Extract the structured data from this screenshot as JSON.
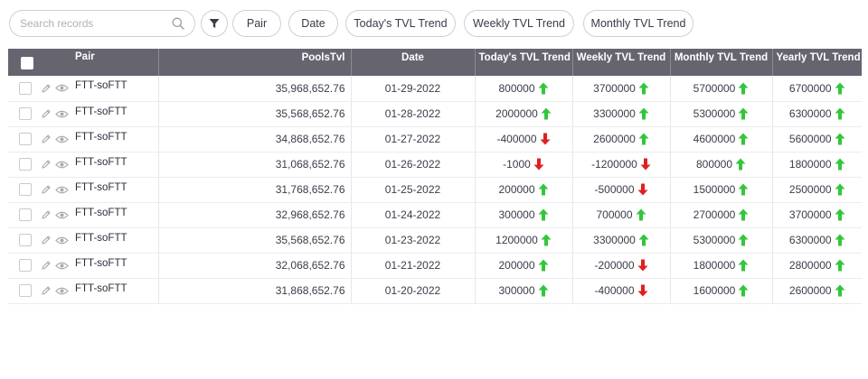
{
  "search": {
    "placeholder": "Search records",
    "value": ""
  },
  "chips": [
    {
      "label": "Pair"
    },
    {
      "label": "Date"
    },
    {
      "label": "Today's TVL Trend"
    },
    {
      "label": "Weekly TVL Trend"
    },
    {
      "label": "Monthly TVL Trend"
    }
  ],
  "table": {
    "headers": {
      "pair": "Pair",
      "pools": "PoolsTvl",
      "date": "Date",
      "today": "Today's TVL Trend",
      "weekly": "Weekly TVL Trend",
      "monthly": "Monthly TVL  Trend",
      "yearly": "Yearly TVL Trend"
    },
    "rows": [
      {
        "pair": "FTT-soFTT",
        "pools": "35,968,652.76",
        "date": "01-29-2022",
        "today": "800000",
        "today_dir": "up",
        "weekly": "3700000",
        "weekly_dir": "up",
        "monthly": "5700000",
        "monthly_dir": "up",
        "yearly": "6700000",
        "yearly_dir": "up"
      },
      {
        "pair": "FTT-soFTT",
        "pools": "35,568,652.76",
        "date": "01-28-2022",
        "today": "2000000",
        "today_dir": "up",
        "weekly": "3300000",
        "weekly_dir": "up",
        "monthly": "5300000",
        "monthly_dir": "up",
        "yearly": "6300000",
        "yearly_dir": "up"
      },
      {
        "pair": "FTT-soFTT",
        "pools": "34,868,652.76",
        "date": "01-27-2022",
        "today": "-400000",
        "today_dir": "down",
        "weekly": "2600000",
        "weekly_dir": "up",
        "monthly": "4600000",
        "monthly_dir": "up",
        "yearly": "5600000",
        "yearly_dir": "up"
      },
      {
        "pair": "FTT-soFTT",
        "pools": "31,068,652.76",
        "date": "01-26-2022",
        "today": "-1000",
        "today_dir": "down",
        "weekly": "-1200000",
        "weekly_dir": "down",
        "monthly": "800000",
        "monthly_dir": "up",
        "yearly": "1800000",
        "yearly_dir": "up"
      },
      {
        "pair": "FTT-soFTT",
        "pools": "31,768,652.76",
        "date": "01-25-2022",
        "today": "200000",
        "today_dir": "up",
        "weekly": "-500000",
        "weekly_dir": "down",
        "monthly": "1500000",
        "monthly_dir": "up",
        "yearly": "2500000",
        "yearly_dir": "up"
      },
      {
        "pair": "FTT-soFTT",
        "pools": "32,968,652.76",
        "date": "01-24-2022",
        "today": "300000",
        "today_dir": "up",
        "weekly": "700000",
        "weekly_dir": "up",
        "monthly": "2700000",
        "monthly_dir": "up",
        "yearly": "3700000",
        "yearly_dir": "up"
      },
      {
        "pair": "FTT-soFTT",
        "pools": "35,568,652.76",
        "date": "01-23-2022",
        "today": "1200000",
        "today_dir": "up",
        "weekly": "3300000",
        "weekly_dir": "up",
        "monthly": "5300000",
        "monthly_dir": "up",
        "yearly": "6300000",
        "yearly_dir": "up"
      },
      {
        "pair": "FTT-soFTT",
        "pools": "32,068,652.76",
        "date": "01-21-2022",
        "today": "200000",
        "today_dir": "up",
        "weekly": "-200000",
        "weekly_dir": "down",
        "monthly": "1800000",
        "monthly_dir": "up",
        "yearly": "2800000",
        "yearly_dir": "up"
      },
      {
        "pair": "FTT-soFTT",
        "pools": "31,868,652.76",
        "date": "01-20-2022",
        "today": "300000",
        "today_dir": "up",
        "weekly": "-400000",
        "weekly_dir": "down",
        "monthly": "1600000",
        "monthly_dir": "up",
        "yearly": "2600000",
        "yearly_dir": "up"
      }
    ]
  },
  "icons": {
    "search": "search-icon",
    "filter": "filter-icon",
    "edit": "pencil-icon",
    "view": "eye-icon",
    "up": "arrow-up-icon",
    "down": "arrow-down-icon"
  },
  "colors": {
    "header_bg": "#66646f",
    "up": "#33c63c",
    "down": "#e02020"
  }
}
